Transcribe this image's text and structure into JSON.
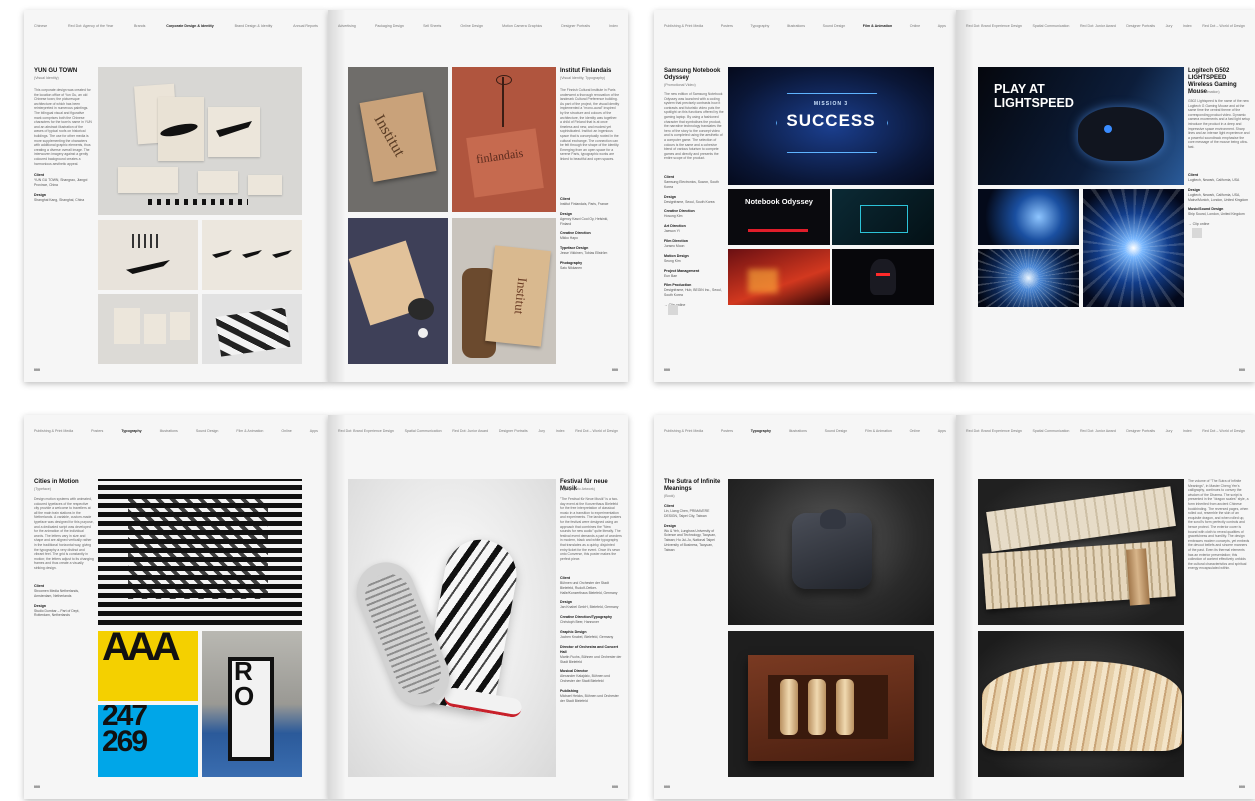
{
  "spread1": {
    "left_nav": [
      "Chinese",
      "Red Dot: Agency of the Year",
      "Brands",
      "Corporate Design & Identity",
      "Brand Design & Identity",
      "Annual Reports"
    ],
    "left_nav_active": 3,
    "right_nav": [
      "Advertising",
      "Packaging Design",
      "Sell Sheets",
      "Online Design",
      "Motion Camera Graphics",
      "Designer Portraits",
      "Index"
    ],
    "p1": {
      "title": "YUN GU TOWN",
      "category": "(Visual Identity)",
      "body": "This corporate design was created for the location office of Yun Gu, an old Chinese town; the picturesque architecture of which has been reinterpreted in numerous paintings. The bilingual visual and figurative mark comprises both the Chinese characters for the town's name in YUN and an abstract illustration of the waves of typical roofs on historical buildings. The use for other media is more supplementing the characters with additional graphic elements, thus creating a diverse overall image. The interwoven imagery against a gently coloured background creates a harmonious aesthetic appeal.",
      "client_label": "Client",
      "client": "YUN GU TOWN, Shangrao, Jiangxi Province, China",
      "design_label": "Design",
      "design": "Shanghai Kang, Shanghai, China",
      "folio": "000"
    },
    "p2": {
      "title": "Institut Finlandais",
      "category": "(Visual Identity, Typography)",
      "body": "The Finnish Cultural Institute in Paris underwent a thorough renovation of the landmark Cultural Preference building. As part of the project, the visual identity implemented a \"mono-aural\" inspired by the structure and colours of the architecture, the identity was together: a child of Finland that is at once timeless and new, and modest yet sophisticated. Institut: an ingenious space that is conceptually rooted in the cultural exchange. The connection can be felt through the shape of the identity. Emerging from an open space for a serene Paris, typographic works are linked to beautiful and open spaces.",
      "client_label": "Client",
      "client": "Institut Finlandais, Paris, France",
      "design_label": "Design",
      "design": "Agency Kasvi Cool Oy, Helsinki, Finland",
      "cd_label": "Creative Direction",
      "cd": "Mikko Hapo",
      "type_label": "Typeface Design",
      "type": "Jesse Vikkinen, Tobias Ellström",
      "photo_label": "Photography",
      "photo": "Satu Nikkanen",
      "folio": "000"
    }
  },
  "spread2": {
    "left_nav": [
      "Publishing & Print Media",
      "Posters",
      "Typography",
      "Illustrations",
      "Sound Design",
      "Film & Animation",
      "Online",
      "Apps"
    ],
    "left_nav_active": 5,
    "right_nav": [
      "Red Dot: Brand Experience Design",
      "Spatial Communication",
      "Red Dot: Junior Award",
      "Designer Portraits",
      "Jury",
      "Index",
      "Red Dot – World of Design"
    ],
    "p1": {
      "title": "Samsung Notebook Odyssey",
      "category": "(Promotional Video)",
      "body": "The new edition of Samsung Notebook Odyssey was launched with a coding system that precisely contrasts how it contrasts and futuristic video puts the spotlight on this functions offered by the gaming laptop. By using a fashioned character that symbolises the product, the narrative technology translates the hero of the story to the concept video and is completed using the aesthetic of a computer game. The selection of colours is the same and a cohesive blend of various futurism to compete games and directly and presents the entire scope of the product.",
      "client_label": "Client",
      "client": "Samsung Electronics, Suwon, South Korea",
      "design_label": "Design",
      "design": "Designframe, Seoul, South Korea",
      "cd_label": "Creative Direction",
      "cd": "Hosung Kim",
      "ad_label": "Art Direction",
      "ad": "Jaewon Yi",
      "fd_label": "Film Direction",
      "fd": "Junseo Moon",
      "md_label": "Motion Design",
      "md": "Seung Kim",
      "pm_label": "Project Management",
      "pm": "Eun Bae",
      "fp_label": "Film Production",
      "fp": "Designframe, Hub, BEGIN Inc., Seoul, South Korea",
      "clip": "→ Clip online",
      "folio": "000",
      "hero_text1": "MISSION 3",
      "hero_text2": "SUCCESS",
      "thumb_text": "Notebook Odyssey"
    },
    "p2": {
      "title": "Logitech G502 LIGHTSPEED Wireless Gaming Mouse",
      "category": "(Product Animation)",
      "body": "G502 Lightspeed is the name of the new Logitech G Gaming Mouse and at the same time the central theme of the corresponding product video. Dynamic camera movements and a fast light setup introduce the product in a deep and impressive space environment. Sharp lines and an intense light experience and a powerful soundtrack emphasise the core message of the mouse being ultra-fast.",
      "client_label": "Client",
      "client": "Logitech, Newark, California, USA",
      "design_label": "Design",
      "design": "Logitech, Newark, California, USA, Mainz/Munich, London, United Kingdom",
      "sound_label": "Music/Sound Design",
      "sound": "Ship Sound, London, United Kingdom",
      "clip": "→ Clip online",
      "folio": "000",
      "hero_text": "PLAY AT LIGHTSPEED"
    }
  },
  "spread3": {
    "left_nav": [
      "Publishing & Print Media",
      "Posters",
      "Typography",
      "Illustrations",
      "Sound Design",
      "Film & Animation",
      "Online",
      "Apps"
    ],
    "left_nav_active": 2,
    "right_nav": [
      "Red Dot: Brand Experience Design",
      "Spatial Communication",
      "Red Dot: Junior Award",
      "Designer Portraits",
      "Jury",
      "Index",
      "Red Dot – World of Design"
    ],
    "p1": {
      "title": "Cities in Motion",
      "category": "(Typeface)",
      "body": "Design motion systems with animated, coloured typefaces of the respective city provide a welcome to travellers at all the main train stations in the Netherlands. A variable, custom-made typeface was designed for this purpose, and a dedicated script was developed for the animation of the individual words. The letters vary in size and shape and are aligned vertically rather in the traditional horizontal way, giving the typography a very distinct and vibrant feel. The grid is constantly in motion; the letters adjust to its changing frames and thus create a visually striking design.",
      "client_label": "Client",
      "client": "Stroomen Media Netherlands, Amsterdam, Netherlands",
      "design_label": "Design",
      "design": "Studio Dumbar – Part of Dept, Rotterdam, Netherlands",
      "folio": "000"
    },
    "p2": {
      "title": "Festival für neue Musik",
      "category": "(Typographic Artwork)",
      "body": "\"The Festival für Neue Musik\" is a two-day event at the Konzerthaus Bielefeld for the free interpretation of classical music in a transition to experimentation and experiments. The landscape posters for the festival were designed using an approach that combines the \"New sounds for new audio\" quite literally. The festival event demands a part of wonders in modern, black and white typography that translates as a quirky, disjointed entry ticket for the event. Once it's sewn onto Converse, this poster makes the perfect piece.",
      "client_label": "Client",
      "client": "Bühnen und Orchester der Stadt Bielefeld, Rudolf-Oetker-Halle/Konzerthaus Bielefeld, Germany",
      "design_label": "Design",
      "design": "Jan Knabel GmbH, Bielefeld, Germany",
      "cd_label": "Creative Direction/Typography",
      "cd": "Christoph Beer, Hannover",
      "gd_label": "Graphic Design",
      "gd": "Jochen Knabel, Bielefeld, Germany",
      "dir_label": "Director of Orchestra and Concert Hall",
      "dir": "Martin Fuchs, Bühnen und Orchester der Stadt Bielefeld",
      "md_label": "Musical Director",
      "md": "Alexander Kalajdzic, Bühnen und Orchester der Stadt Bielefeld",
      "pub_label": "Publishing",
      "pub": "Michael Heicks, Bühnen und Orchester der Stadt Bielefeld",
      "folio": "000"
    }
  },
  "spread4": {
    "left_nav": [
      "Publishing & Print Media",
      "Posters",
      "Typography",
      "Illustrations",
      "Sound Design",
      "Film & Animation",
      "Online",
      "Apps"
    ],
    "left_nav_active": 2,
    "right_nav": [
      "Red Dot: Brand Experience Design",
      "Spatial Communication",
      "Red Dot: Junior Award",
      "Designer Portraits",
      "Jury",
      "Index",
      "Red Dot – World of Design"
    ],
    "p1": {
      "title": "The Sutra of Infinite Meanings",
      "category": "(Book)",
      "client_label": "Client",
      "client": "Lin, Liang Chen, PRIMAVERE DESIGN, Taipei City, Taiwan",
      "design_label": "Design",
      "design": "Wu & Yeh, Lunghwa University of Science and Technology, Taoyuan, Taiwan; Hu Jui-Ju, National Taipei University of Business, Taoyuan, Taiwan",
      "folio": "000"
    },
    "p2": {
      "body": "The volume of \"The Sutra of Infinite Meanings\", in Master Cheng Yen's calligraphy, continues to convey the wisdom of the Dharma. The script is presented in the \"dragon scales\" style, a form inherited from ancient Chinese bookbinding. The reversed pages, when rolled out, resemble the skin of an exquisite dragon, and when rolled up, the scroll's form perfectly controls and hence protect. The exterior cover is bound with cloth to reveal qualities of gracefulness and humility. The design embraces modern concepts, yet embeds the devout beliefs and sincere manners of the past. Even its thermal elements has an exterior presentation; this collection of content effectively unfolds the cultural characteristics and spiritual energy encapsulated within.",
      "folio": "000"
    }
  },
  "colors": {
    "page": "#f6f6f6",
    "cream": "#ece6db",
    "terracotta": "#b0553e",
    "blue_hud": "#1b3f8f",
    "dark": "#0d0d12",
    "yellow": "#f4d000",
    "cyan": "#00a6e8",
    "wood": "#5a2d1b",
    "paper": "#d9c8a8"
  }
}
